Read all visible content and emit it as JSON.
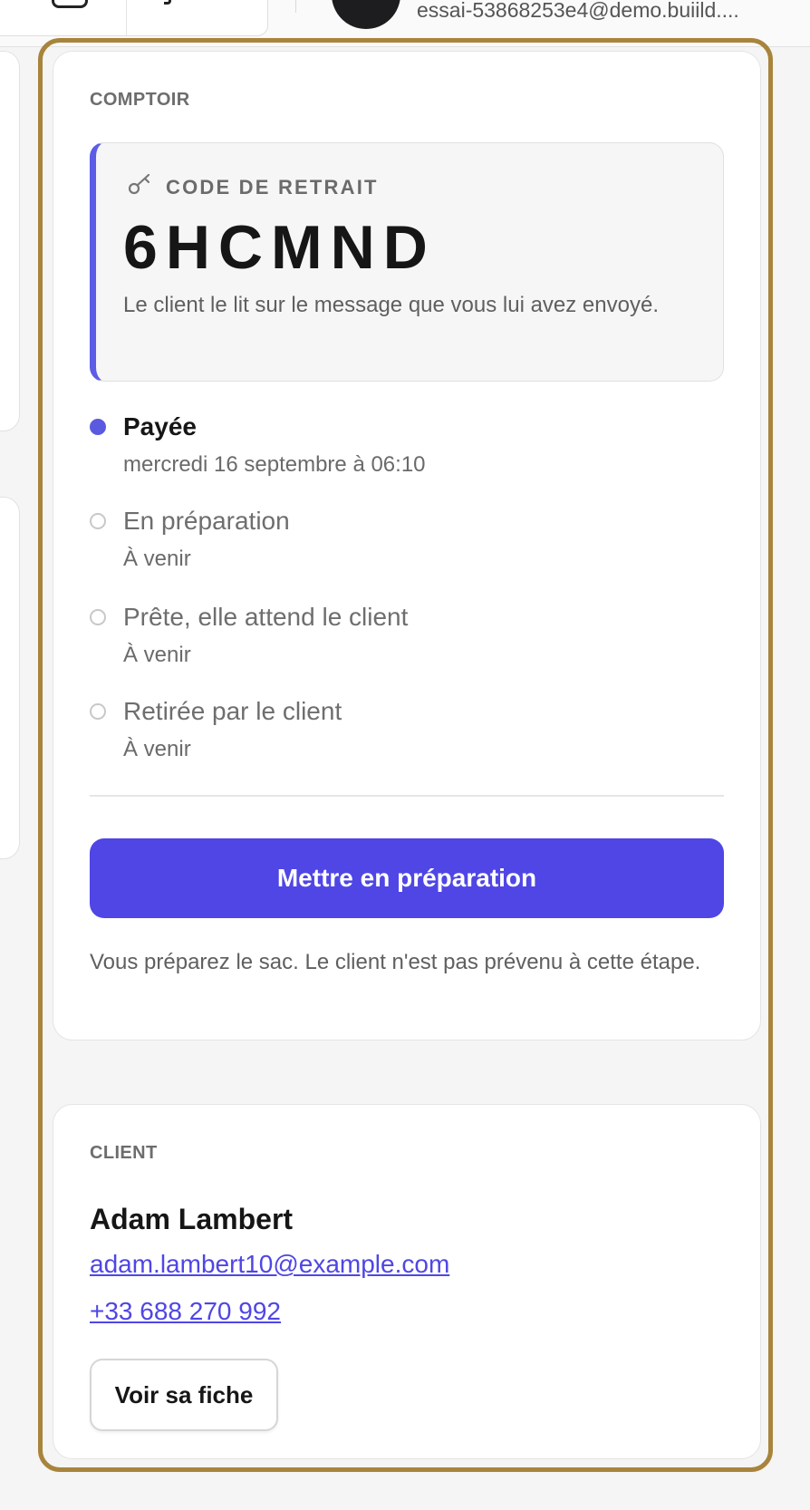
{
  "header": {
    "account_email": "essai-53868253e4@demo.buiild...."
  },
  "counter_card": {
    "section_label": "COMPTOIR",
    "pickup_code": {
      "label": "CODE DE RETRAIT",
      "icon": "key-icon",
      "value": "6HCMND",
      "hint": "Le client le lit sur le message que vous lui avez envoyé."
    },
    "steps": [
      {
        "title": "Payée",
        "subtitle": "mercredi 16 septembre à 06:10",
        "state": "done"
      },
      {
        "title": "En préparation",
        "subtitle": "À venir",
        "state": "pending"
      },
      {
        "title": "Prête, elle attend le client",
        "subtitle": "À venir",
        "state": "pending"
      },
      {
        "title": "Retirée par le client",
        "subtitle": "À venir",
        "state": "pending"
      }
    ],
    "primary_action_label": "Mettre en préparation",
    "primary_action_hint": "Vous préparez le sac. Le client n'est pas prévenu à cette étape."
  },
  "client_card": {
    "section_label": "CLIENT",
    "name": "Adam Lambert",
    "email": "adam.lambert10@example.com",
    "phone": "+33 688 270 992",
    "view_profile_label": "Voir sa fiche"
  },
  "colors": {
    "accent": "#4f46e5",
    "active_step": "#5a5ae0",
    "highlight_border": "#a8843c"
  }
}
